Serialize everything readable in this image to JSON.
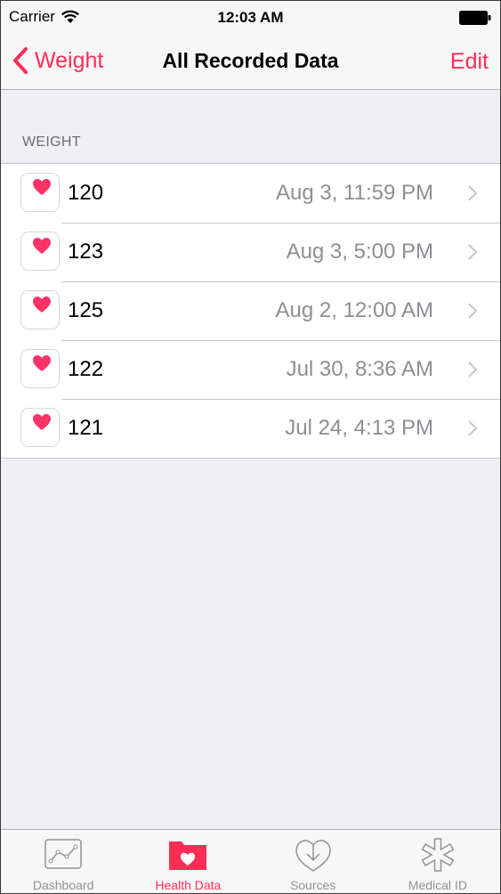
{
  "status": {
    "carrier": "Carrier",
    "time": "12:03 AM"
  },
  "nav": {
    "back_label": "Weight",
    "title": "All Recorded Data",
    "edit_label": "Edit"
  },
  "section": {
    "header": "WEIGHT"
  },
  "rows": [
    {
      "value": "120",
      "date": "Aug 3, 11:59 PM"
    },
    {
      "value": "123",
      "date": "Aug 3, 5:00 PM"
    },
    {
      "value": "125",
      "date": "Aug 2, 12:00 AM"
    },
    {
      "value": "122",
      "date": "Jul 30, 8:36 AM"
    },
    {
      "value": "121",
      "date": "Jul 24, 4:13 PM"
    }
  ],
  "tabs": [
    {
      "label": "Dashboard",
      "icon": "dashboard-chart-icon",
      "active": false
    },
    {
      "label": "Health Data",
      "icon": "health-data-folder-icon",
      "active": true
    },
    {
      "label": "Sources",
      "icon": "sources-download-icon",
      "active": false
    },
    {
      "label": "Medical ID",
      "icon": "medical-id-asterisk-icon",
      "active": false
    }
  ],
  "colors": {
    "accent": "#ff2d55",
    "background": "#efeff4",
    "secondary_text": "#8e8e93",
    "tab_inactive": "#929292"
  }
}
